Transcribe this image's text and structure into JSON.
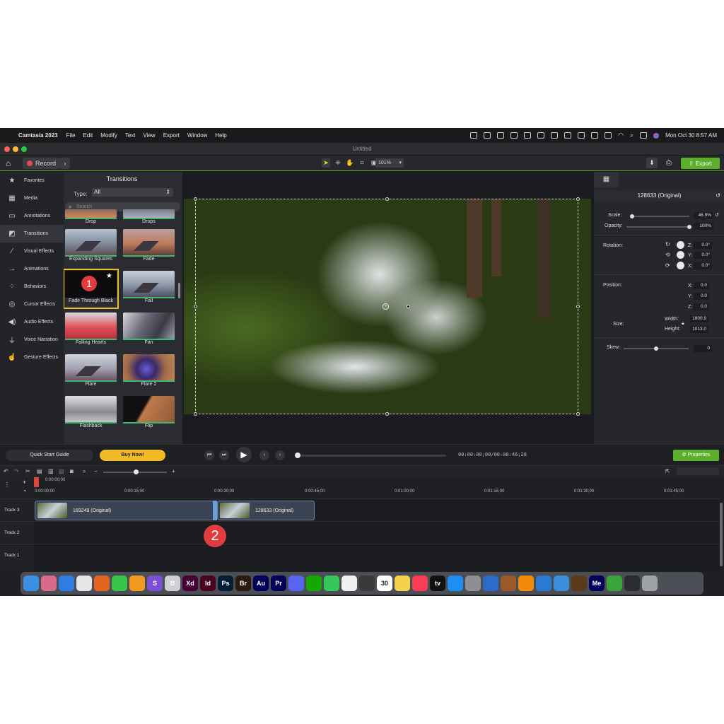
{
  "menubar": {
    "app": "Camtasia 2023",
    "items": [
      "File",
      "Edit",
      "Modify",
      "Text",
      "View",
      "Export",
      "Window",
      "Help"
    ],
    "clock": "Mon Oct 30  8:57 AM"
  },
  "window": {
    "title": "Untitled"
  },
  "toolbar": {
    "record_label": "Record",
    "zoom": "101%",
    "export_label": "Export"
  },
  "leftnav": {
    "items": [
      {
        "label": "Favorites",
        "icon": "star-icon"
      },
      {
        "label": "Media",
        "icon": "film-icon"
      },
      {
        "label": "Annotations",
        "icon": "annotation-icon"
      },
      {
        "label": "Transitions",
        "icon": "transition-icon"
      },
      {
        "label": "Visual Effects",
        "icon": "wand-icon"
      },
      {
        "label": "Animations",
        "icon": "animation-icon"
      },
      {
        "label": "Behaviors",
        "icon": "behavior-icon"
      },
      {
        "label": "Cursor Effects",
        "icon": "cursor-icon"
      },
      {
        "label": "Audio Effects",
        "icon": "audio-icon"
      },
      {
        "label": "Voice Narration",
        "icon": "mic-icon"
      },
      {
        "label": "Gesture Effects",
        "icon": "gesture-icon"
      }
    ]
  },
  "transitions": {
    "title": "Transitions",
    "type_label": "Type:",
    "type_value": "All",
    "search_placeholder": "Search",
    "tiles": [
      {
        "label": "Drop"
      },
      {
        "label": "Drops"
      },
      {
        "label": "Expanding Squares"
      },
      {
        "label": "Fade"
      },
      {
        "label": "Fade Through Black"
      },
      {
        "label": "Fall"
      },
      {
        "label": "Falling Hearts"
      },
      {
        "label": "Fan"
      },
      {
        "label": "Flare"
      },
      {
        "label": "Flare 2"
      },
      {
        "label": "Flashback"
      },
      {
        "label": "Flip"
      }
    ]
  },
  "annotations": {
    "badge1": "1",
    "badge2": "2"
  },
  "properties": {
    "clip_title": "128633 (Original)",
    "scale_label": "Scale:",
    "scale_value": "46.9%",
    "scale_fraction": 0.03,
    "opacity_label": "Opacity:",
    "opacity_value": "100%",
    "opacity_fraction": 1.0,
    "rotation_label": "Rotation:",
    "rot_z_label": "Z:",
    "rot_z": "0.0°",
    "rot_y_label": "Y:",
    "rot_y": "0.0°",
    "rot_x_label": "X:",
    "rot_x": "0.0°",
    "position_label": "Position:",
    "pos_x_label": "X:",
    "pos_x": "0.0",
    "pos_y_label": "Y:",
    "pos_y": "0.0",
    "pos_z_label": "Z:",
    "pos_z": "0.0",
    "size_label": "Size:",
    "width_label": "Width:",
    "width": "1800.9",
    "height_label": "Height:",
    "height": "1013.0",
    "skew_label": "Skew:",
    "skew_value": "0",
    "skew_fraction": 0.5
  },
  "transport": {
    "quick_start": "Quick Start Guide",
    "buy_now": "Buy Now!",
    "timecode": "00:00:00;00/00:00:46;28",
    "properties_label": "Properties"
  },
  "timeline": {
    "playhead_time": "0:00:00;00",
    "ticks": [
      "0:00:00;00",
      "0:00:15;00",
      "0:00:30;00",
      "0:00:45;00",
      "0:01:00;00",
      "0:01:15;00",
      "0:01:30;00",
      "0:01:45;00"
    ],
    "tracks": [
      "Track 3",
      "Track 2",
      "Track 1"
    ],
    "clips": [
      {
        "label": "169249 (Original)"
      },
      {
        "label": "128633 (Original)"
      }
    ]
  },
  "dock": {
    "apps": [
      {
        "icon": "finder-icon",
        "text": "",
        "color": "#3b8fe0"
      },
      {
        "icon": "launchpad-icon",
        "text": "",
        "color": "#d86a8a"
      },
      {
        "icon": "safari-icon",
        "text": "",
        "color": "#2f7de0"
      },
      {
        "icon": "chrome-icon",
        "text": "",
        "color": "#e6e6e6"
      },
      {
        "icon": "firefox-icon",
        "text": "",
        "color": "#e2661f"
      },
      {
        "icon": "facetime-icon",
        "text": "",
        "color": "#39c44a"
      },
      {
        "icon": "pages-icon",
        "text": "",
        "color": "#f29a1d"
      },
      {
        "icon": "s-app-icon",
        "text": "S",
        "color": "#7b4fd8"
      },
      {
        "icon": "b-app-icon",
        "text": "B",
        "color": "#cfcfd6"
      },
      {
        "icon": "xd-icon",
        "text": "Xd",
        "color": "#470137"
      },
      {
        "icon": "indesign-icon",
        "text": "Id",
        "color": "#49021f"
      },
      {
        "icon": "photoshop-icon",
        "text": "Ps",
        "color": "#001e36"
      },
      {
        "icon": "bridge-icon",
        "text": "Br",
        "color": "#2b1a0e"
      },
      {
        "icon": "audition-icon",
        "text": "Au",
        "color": "#00005b"
      },
      {
        "icon": "premiere-icon",
        "text": "Pr",
        "color": "#00005b"
      },
      {
        "icon": "discord-icon",
        "text": "",
        "color": "#5865f2"
      },
      {
        "icon": "upwork-icon",
        "text": "",
        "color": "#14a800"
      },
      {
        "icon": "messages-icon",
        "text": "",
        "color": "#35c759"
      },
      {
        "icon": "photos-icon",
        "text": "",
        "color": "#f0f0f0"
      },
      {
        "icon": "calculator-icon",
        "text": "",
        "color": "#3a3a3c"
      },
      {
        "icon": "calendar-icon",
        "text": "30",
        "color": "#ffffff"
      },
      {
        "icon": "notes-icon",
        "text": "",
        "color": "#f5d24b"
      },
      {
        "icon": "music-icon",
        "text": "",
        "color": "#fa3c56"
      },
      {
        "icon": "appletv-icon",
        "text": "tv",
        "color": "#111"
      },
      {
        "icon": "appstore-icon",
        "text": "",
        "color": "#1c8ef5"
      },
      {
        "icon": "settings-icon",
        "text": "",
        "color": "#8e8e93"
      },
      {
        "icon": "quicktime-icon",
        "text": "",
        "color": "#2c6bc7"
      },
      {
        "icon": "app-icon",
        "text": "",
        "color": "#9a5a2a"
      },
      {
        "icon": "vlc-icon",
        "text": "",
        "color": "#f28a0c"
      },
      {
        "icon": "mapp-icon",
        "text": "",
        "color": "#2a7ad4"
      },
      {
        "icon": "camtasia-icon",
        "text": "",
        "color": "#3b8ed9"
      },
      {
        "icon": "guitar-icon",
        "text": "",
        "color": "#5a3a1a"
      },
      {
        "icon": "media-encoder-icon",
        "text": "Me",
        "color": "#00005b"
      },
      {
        "icon": "camtasia-rec-icon",
        "text": "",
        "color": "#3aa33a"
      },
      {
        "icon": "folder-icon",
        "text": "",
        "color": "#2a2c30"
      },
      {
        "icon": "trash-icon",
        "text": "",
        "color": "#9fa3a8"
      }
    ]
  }
}
